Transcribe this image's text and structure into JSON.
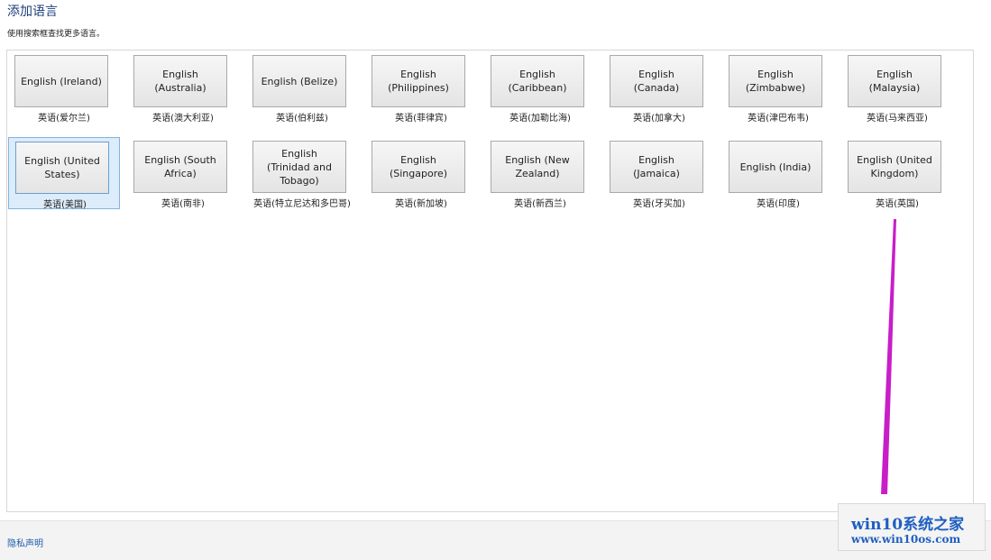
{
  "page": {
    "title": "添加语言",
    "subtitle": "使用搜索框查找更多语言。"
  },
  "languages": [
    {
      "name": "English (Ireland)",
      "caption": "英语(爱尔兰)",
      "selected": false
    },
    {
      "name": "English (Australia)",
      "caption": "英语(澳大利亚)",
      "selected": false
    },
    {
      "name": "English (Belize)",
      "caption": "英语(伯利兹)",
      "selected": false
    },
    {
      "name": "English (Philippines)",
      "caption": "英语(菲律宾)",
      "selected": false
    },
    {
      "name": "English (Caribbean)",
      "caption": "英语(加勒比海)",
      "selected": false
    },
    {
      "name": "English (Canada)",
      "caption": "英语(加拿大)",
      "selected": false
    },
    {
      "name": "English (Zimbabwe)",
      "caption": "英语(津巴布韦)",
      "selected": false
    },
    {
      "name": "English (Malaysia)",
      "caption": "英语(马来西亚)",
      "selected": false
    },
    {
      "name": "English (United States)",
      "caption": "英语(美国)",
      "selected": true
    },
    {
      "name": "English (South Africa)",
      "caption": "英语(南非)",
      "selected": false
    },
    {
      "name": "English (Trinidad and Tobago)",
      "caption": "英语(特立尼达和多巴哥)",
      "selected": false
    },
    {
      "name": "English (Singapore)",
      "caption": "英语(新加坡)",
      "selected": false
    },
    {
      "name": "English (New Zealand)",
      "caption": "英语(新西兰)",
      "selected": false
    },
    {
      "name": "English (Jamaica)",
      "caption": "英语(牙买加)",
      "selected": false
    },
    {
      "name": "English (India)",
      "caption": "英语(印度)",
      "selected": false
    },
    {
      "name": "English (United Kingdom)",
      "caption": "英语(英国)",
      "selected": false
    }
  ],
  "footer": {
    "privacy_label": "隐私声明"
  },
  "annotation": {
    "arrow_color": "#c81ec8"
  },
  "watermark": {
    "title": "win10系统之家",
    "url": "www.win10os.com"
  }
}
